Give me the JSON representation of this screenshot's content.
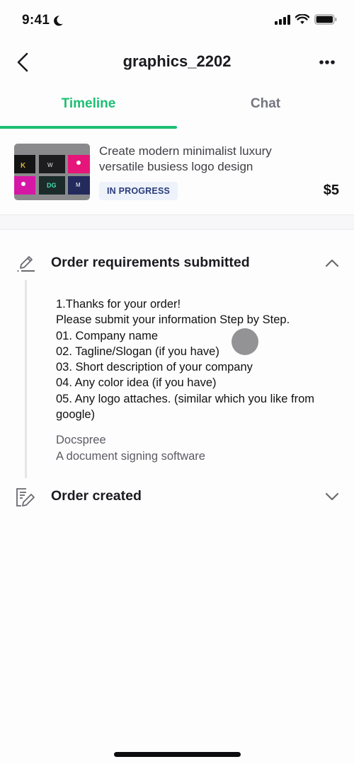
{
  "status_bar": {
    "time": "9:41",
    "icons": [
      "moon-icon",
      "cellular-signal-icon",
      "wifi-icon",
      "battery-icon"
    ]
  },
  "header": {
    "title": "graphics_2202",
    "back_icon": "chevron-left-icon",
    "more_icon": "more-horizontal-icon"
  },
  "tabs": [
    {
      "label": "Timeline",
      "active": true
    },
    {
      "label": "Chat",
      "active": false
    }
  ],
  "order": {
    "title": "Create modern minimalist luxury versatile busiess logo design",
    "status": "IN PROGRESS",
    "price": "$5"
  },
  "timeline": {
    "events": [
      {
        "title": "Order requirements submitted",
        "icon": "pencil-icon",
        "expanded": true,
        "requirements": [
          "1.Thanks for your order!",
          "Please submit your information Step by Step.",
          "01. Company name",
          "02. Tagline/Slogan (if you have)",
          "03. Short description of your company",
          "04. Any color idea (if you have)",
          "05. Any logo attaches. (similar which you like from google)"
        ],
        "answer": [
          "Docspree",
          "A document signing software"
        ]
      },
      {
        "title": "Order created",
        "icon": "edit-document-icon",
        "expanded": false
      }
    ]
  },
  "colors": {
    "accent": "#1dbf73",
    "badge_bg": "#eef2fb",
    "badge_text": "#2b3d7a",
    "inactive_tab": "#74767e"
  }
}
